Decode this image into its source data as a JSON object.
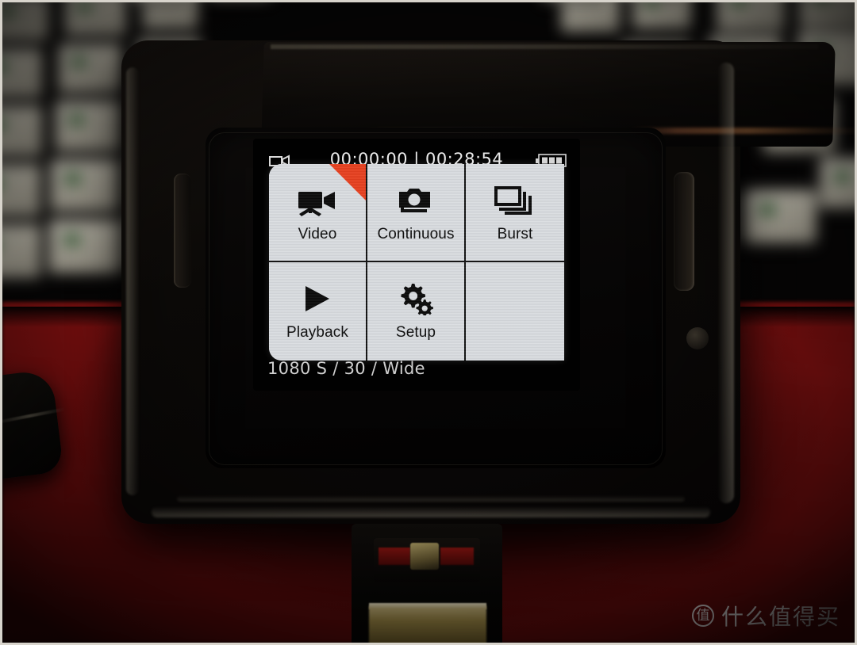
{
  "photo": {
    "subject": "action-camera-in-waterproof-housing",
    "frame_border_color": "#d8d4cc"
  },
  "background": {
    "surface_label": "red-desk-mat",
    "surface_color": "#8d1212",
    "keyboard_label": "blurred-mechanical-keyboard",
    "keycap_color": "#e2ddcd",
    "legend_color": "#2f6b33"
  },
  "camera": {
    "housing_label": "waterproof-case",
    "housing_color": "#0b0907",
    "mount_label": "tripod-mount",
    "screw_color": "#b5a468"
  },
  "lcd": {
    "status_bar": {
      "mode_icon": "video-camera-icon",
      "recorded_time": "00:00:00",
      "separator": "|",
      "remaining_time": "00:28:54",
      "timecode": "00:00:00 | 00:28:54",
      "battery_icon": "battery-icon",
      "battery_bars": 3
    },
    "footer": {
      "settings": "1080 S / 30 / Wide",
      "resolution": "1080 S",
      "framerate": "30",
      "fov": "Wide"
    },
    "menu": {
      "panel_bg": "#dadde1",
      "active_tile_marker_color": "#e8401f",
      "tiles": [
        {
          "id": "video",
          "label": "Video",
          "icon": "video-camera-icon",
          "active": true,
          "empty": false
        },
        {
          "id": "continuous",
          "label": "Continuous",
          "icon": "camera-stack-icon",
          "active": false,
          "empty": false
        },
        {
          "id": "burst",
          "label": "Burst",
          "icon": "burst-frames-icon",
          "active": false,
          "empty": false
        },
        {
          "id": "playback",
          "label": "Playback",
          "icon": "play-triangle-icon",
          "active": false,
          "empty": false
        },
        {
          "id": "setup",
          "label": "Setup",
          "icon": "gears-icon",
          "active": false,
          "empty": false
        },
        {
          "id": "blank",
          "label": "",
          "icon": "",
          "active": false,
          "empty": true
        }
      ]
    }
  },
  "watermark": {
    "badge": "值",
    "text": "什么值得买"
  }
}
